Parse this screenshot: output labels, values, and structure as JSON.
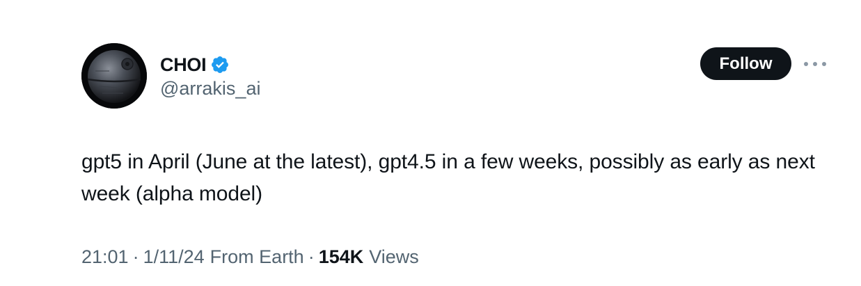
{
  "author": {
    "display_name": "CHOI",
    "handle": "@arrakis_ai",
    "verified": true,
    "avatar": "death-star-avatar"
  },
  "actions": {
    "follow_label": "Follow",
    "more_icon": "more-horizontal-icon"
  },
  "tweet": {
    "text": "gpt5 in April (June at the latest), gpt4.5 in a few weeks, possibly as early as next week (alpha model)"
  },
  "meta": {
    "time": "21:01",
    "separator": "·",
    "date": "1/11/24",
    "source": "From Earth",
    "views_count": "154K",
    "views_label": "Views"
  },
  "colors": {
    "verified_badge": "#1d9bf0",
    "follow_bg": "#0f1419",
    "secondary_text": "#536471"
  }
}
